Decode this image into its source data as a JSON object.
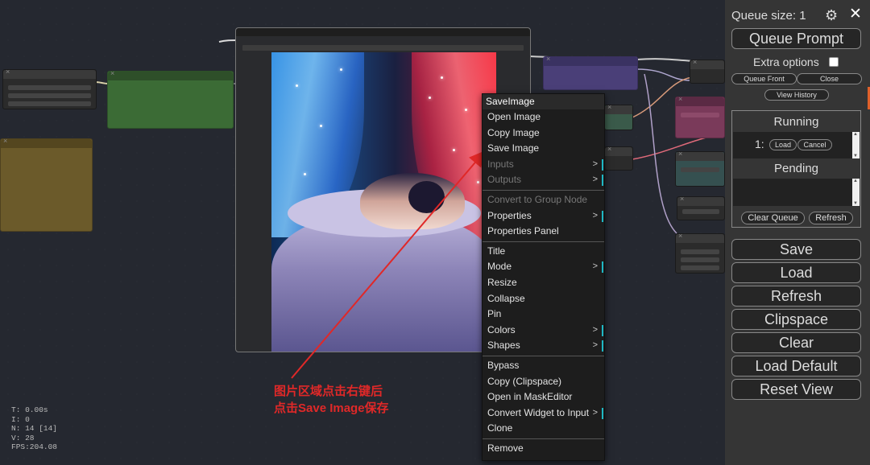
{
  "canvas": {
    "image_node": {
      "label": "SaveImage preview"
    },
    "context_menu": {
      "title": "SaveImage",
      "groups": [
        [
          {
            "label": "Open Image",
            "submenu": false,
            "disabled": false
          },
          {
            "label": "Copy Image",
            "submenu": false,
            "disabled": false
          },
          {
            "label": "Save Image",
            "submenu": false,
            "disabled": false
          },
          {
            "label": "Inputs",
            "submenu": true,
            "disabled": true
          },
          {
            "label": "Outputs",
            "submenu": true,
            "disabled": true
          }
        ],
        [
          {
            "label": "Convert to Group Node",
            "submenu": false,
            "disabled": true
          },
          {
            "label": "Properties",
            "submenu": true,
            "disabled": false
          },
          {
            "label": "Properties Panel",
            "submenu": false,
            "disabled": false
          }
        ],
        [
          {
            "label": "Title",
            "submenu": false,
            "disabled": false
          },
          {
            "label": "Mode",
            "submenu": true,
            "disabled": false
          },
          {
            "label": "Resize",
            "submenu": false,
            "disabled": false
          },
          {
            "label": "Collapse",
            "submenu": false,
            "disabled": false
          },
          {
            "label": "Pin",
            "submenu": false,
            "disabled": false
          },
          {
            "label": "Colors",
            "submenu": true,
            "disabled": false
          },
          {
            "label": "Shapes",
            "submenu": true,
            "disabled": false
          }
        ],
        [
          {
            "label": "Bypass",
            "submenu": false,
            "disabled": false
          },
          {
            "label": "Copy (Clipspace)",
            "submenu": false,
            "disabled": false
          },
          {
            "label": "Open in MaskEditor",
            "submenu": false,
            "disabled": false
          },
          {
            "label": "Convert Widget to Input",
            "submenu": true,
            "disabled": false
          },
          {
            "label": "Clone",
            "submenu": false,
            "disabled": false
          }
        ],
        [
          {
            "label": "Remove",
            "submenu": false,
            "disabled": false
          }
        ]
      ]
    },
    "annotation": {
      "line1": "图片区域点击右键后",
      "line2": "点击Save Image保存",
      "color": "#e02828"
    },
    "stats": {
      "t": "T: 0.00s",
      "i": "I: 0",
      "n": "N: 14 [14]",
      "v": "V: 28",
      "fps": "FPS:204.08"
    }
  },
  "panel": {
    "queue_size": "Queue size: 1",
    "gear_icon": "gear-icon",
    "close_icon": "close-icon",
    "queue_prompt": "Queue Prompt",
    "extra_options": "Extra options",
    "queue_front": "Queue Front",
    "close": "Close",
    "view_history": "View History",
    "running": "Running",
    "running_item": "1:",
    "load_small": "Load",
    "cancel": "Cancel",
    "pending": "Pending",
    "clear_queue": "Clear Queue",
    "refresh_small": "Refresh",
    "buttons": [
      "Save",
      "Load",
      "Refresh",
      "Clipspace",
      "Clear",
      "Load Default",
      "Reset View"
    ]
  }
}
